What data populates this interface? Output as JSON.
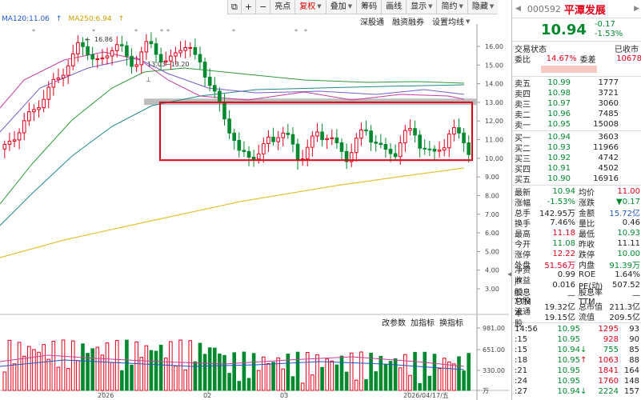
{
  "toolbar": {
    "items": [
      "亮点",
      "复权",
      "叠加",
      "筹码",
      "画线",
      "显示",
      "简约",
      "隐藏"
    ],
    "selected_index": 1,
    "caret_indices": [
      1,
      2,
      5,
      6,
      7
    ]
  },
  "ma_legend": {
    "ma120": "MA120:11.06",
    "ma250": "MA250:6.94"
  },
  "actions": {
    "deep_link": "深股通",
    "margin": "融资融券",
    "settings": "设置均线",
    "change_params": "改参数",
    "add_indicator": "加指标",
    "swap_indicator": "换指标"
  },
  "chart": {
    "price_axis": [
      "16.00",
      "15.00",
      "14.00",
      "13.00",
      "12.00",
      "11.00",
      "10.00",
      "9.00",
      "8.00",
      "7.00",
      "6.00",
      "5.00",
      "4.00",
      "3.00"
    ],
    "volume_axis": [
      "981.00",
      "651.00",
      "330.00",
      "万"
    ],
    "date_axis": [
      "2026",
      "02",
      "03",
      "2026/04/17/五"
    ],
    "annotations": {
      "high_label": "16.86",
      "range_label": "13.03~13.20"
    },
    "highlight_box_color": "#e0001a",
    "candle_up_color": "#e0001a",
    "candle_down_color": "#00892e"
  },
  "stock": {
    "code": "000592",
    "name": "平潭发展",
    "price": "10.94",
    "change": "-0.17",
    "change_pct": "-1.53%",
    "status_label": "交易状态",
    "status_value": "已收市",
    "wb_label": "委比",
    "wb_value": "14.67%",
    "wc_label": "委差",
    "wc_value": "10678"
  },
  "order_book": {
    "asks": [
      {
        "label": "卖五",
        "price": "10.99",
        "qty": "1777"
      },
      {
        "label": "卖四",
        "price": "10.98",
        "qty": "3721"
      },
      {
        "label": "卖三",
        "price": "10.97",
        "qty": "3060"
      },
      {
        "label": "卖二",
        "price": "10.96",
        "qty": "7485"
      },
      {
        "label": "卖一",
        "price": "10.95",
        "qty": "15008"
      }
    ],
    "bids": [
      {
        "label": "买一",
        "price": "10.94",
        "qty": "3603"
      },
      {
        "label": "买二",
        "price": "10.93",
        "qty": "11966"
      },
      {
        "label": "买三",
        "price": "10.92",
        "qty": "4742"
      },
      {
        "label": "买四",
        "price": "10.91",
        "qty": "4502"
      },
      {
        "label": "买五",
        "price": "10.90",
        "qty": "16916"
      }
    ]
  },
  "stats": [
    {
      "k": "最新",
      "v": "10.94",
      "vc": "green",
      "k2": "均价",
      "v2": "11.00",
      "v2c": "red"
    },
    {
      "k": "涨幅",
      "v": "-1.53%",
      "vc": "green",
      "k2": "涨跌",
      "v2": "▼0.17",
      "v2c": "green"
    },
    {
      "k": "总手",
      "v": "142.95万",
      "vc": "",
      "k2": "金额",
      "v2": "15.72亿",
      "v2c": "blue"
    },
    {
      "k": "换手",
      "v": "7.46%",
      "vc": "",
      "k2": "量比",
      "v2": "0.46",
      "v2c": ""
    },
    {
      "k": "最高",
      "v": "11.18",
      "vc": "red",
      "k2": "最低",
      "v2": "10.93",
      "v2c": "green"
    },
    {
      "k": "今开",
      "v": "11.08",
      "vc": "green",
      "k2": "昨收",
      "v2": "11.11",
      "v2c": ""
    },
    {
      "k": "涨停",
      "v": "12.22",
      "vc": "red",
      "k2": "跌停",
      "v2": "10.00",
      "v2c": "green"
    },
    {
      "k": "外盘",
      "v": "51.56万",
      "vc": "red",
      "k2": "内盘",
      "v2": "91.39万",
      "v2c": "green"
    },
    {
      "k": "净资产",
      "v": "0.99",
      "vc": "",
      "k2": "ROE",
      "v2": "1.64%",
      "v2c": ""
    },
    {
      "k": "收益㈢",
      "v": "0.016",
      "vc": "",
      "k2": "PE(动)",
      "v2": "507.52",
      "v2c": ""
    },
    {
      "k": "股息TTM",
      "v": "—",
      "vc": "",
      "k2": "股息率TTM",
      "v2": "—",
      "v2c": ""
    },
    {
      "k": "总股本",
      "v": "19.32亿",
      "vc": "",
      "k2": "总市值",
      "v2": "211.3亿",
      "v2c": ""
    },
    {
      "k": "流通股",
      "v": "19.15亿",
      "vc": "",
      "k2": "流值",
      "v2": "209.5亿",
      "v2c": ""
    }
  ],
  "ticks": [
    {
      "t": "14:56",
      "p": "10.95",
      "pc": "green",
      "ar": "",
      "q": "1295",
      "qc": "red",
      "c": "93"
    },
    {
      "t": ":15",
      "p": "10.95",
      "pc": "green",
      "ar": "",
      "q": "928",
      "qc": "red",
      "c": "90"
    },
    {
      "t": ":15",
      "p": "10.94",
      "pc": "green",
      "ar": "↓",
      "q": "755",
      "qc": "green",
      "c": "85"
    },
    {
      "t": ":18",
      "p": "10.95",
      "pc": "green",
      "ar": "↑",
      "q": "1063",
      "qc": "red",
      "c": "88"
    },
    {
      "t": ":21",
      "p": "10.95",
      "pc": "green",
      "ar": "",
      "q": "1841",
      "qc": "red",
      "c": "164"
    },
    {
      "t": ":24",
      "p": "10.95",
      "pc": "green",
      "ar": "",
      "q": "1760",
      "qc": "red",
      "c": "148"
    },
    {
      "t": ":27",
      "p": "10.94",
      "pc": "green",
      "ar": "↓",
      "q": "2224",
      "qc": "green",
      "c": "157"
    }
  ]
}
